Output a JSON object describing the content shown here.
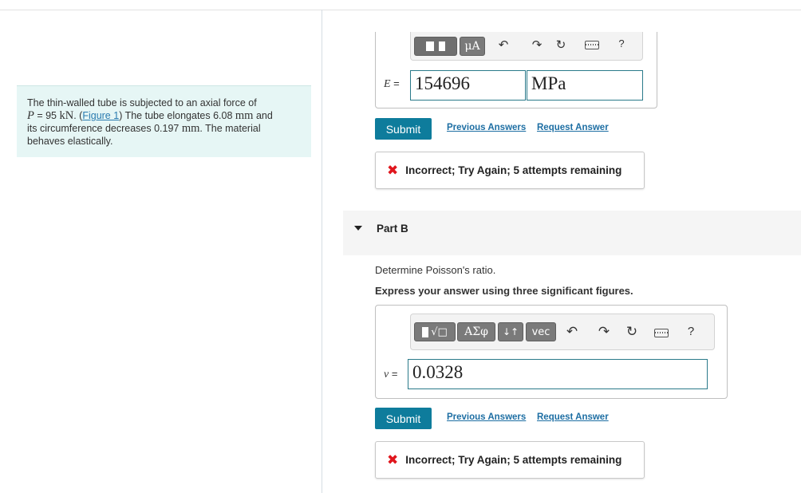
{
  "problem": {
    "line1": "The thin-walled tube is subjected to an axial force of",
    "force_var": "P",
    "force_eq": " = 95 ",
    "force_unit": "kN",
    "sep": ". (",
    "figure_link": "Figure 1",
    "after_link": ") The tube elongates 6.08 ",
    "mm1": "mm",
    "and": " and",
    "line3_a": "its circumference decreases 0.197 ",
    "mm2": "mm",
    "line3_b": ". The material",
    "line4": "behaves elastically."
  },
  "part_a": {
    "toolbar": {
      "mu_label": "μA",
      "question": "?"
    },
    "var_name": "E",
    "var_eq": " =",
    "answer_value": "154696",
    "unit_value": "MPa",
    "submit_label": "Submit",
    "previous_answers": "Previous Answers",
    "request_answer": "Request Answer",
    "feedback": "Incorrect; Try Again; 5 attempts remaining"
  },
  "part_b": {
    "title": "Part B",
    "prompt": "Determine Poisson's ratio.",
    "instruction": "Express your answer using three significant figures.",
    "toolbar": {
      "greek_label": "ΑΣφ",
      "arrows_label": "↓↑",
      "vec_label": "vec",
      "question": "?"
    },
    "var_name": "ν",
    "var_eq": " =",
    "answer_value": "0.0328",
    "submit_label": "Submit",
    "previous_answers": "Previous Answers",
    "request_answer": "Request Answer",
    "feedback": "Incorrect; Try Again; 5 attempts remaining"
  },
  "colors": {
    "submit": "#0e7c9c",
    "link": "#1d6ea3",
    "error": "#e0161d",
    "problem_bg": "#e6f6f5"
  }
}
